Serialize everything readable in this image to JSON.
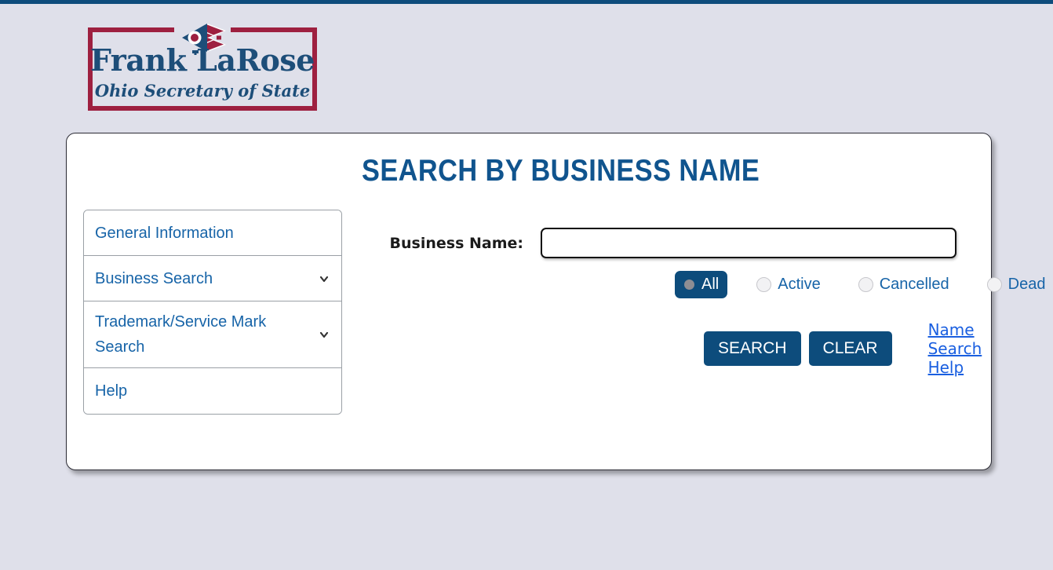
{
  "theme": {
    "accent_navy": "#0d4c7c",
    "title_blue": "#10548e",
    "link_blue": "#1a5fe0",
    "nav_blue": "#1764a8",
    "logo_crimson": "#9e2040",
    "page_background": "#dfe0ea"
  },
  "header": {
    "logo": {
      "name": "Frank LaRose",
      "subtitle": "Ohio Secretary of State",
      "flag_icon": "ohio-burgee-flag-icon"
    }
  },
  "main": {
    "page_title": "SEARCH BY BUSINESS NAME"
  },
  "sidebar": {
    "items": [
      {
        "label": "General Information",
        "has_chevron": false
      },
      {
        "label": "Business Search",
        "has_chevron": true
      },
      {
        "label": "Trademark/Service Mark Search",
        "has_chevron": true
      },
      {
        "label": "Help",
        "has_chevron": false
      }
    ]
  },
  "form": {
    "business_name": {
      "label": "Business Name:",
      "value": "",
      "placeholder": ""
    },
    "status_filter": {
      "options": [
        {
          "label": "All",
          "selected": true
        },
        {
          "label": "Active",
          "selected": false
        },
        {
          "label": "Cancelled",
          "selected": false
        },
        {
          "label": "Dead",
          "selected": false
        }
      ]
    },
    "actions": {
      "search_label": "SEARCH",
      "clear_label": "CLEAR",
      "help_link_label": "Name Search Help"
    }
  }
}
